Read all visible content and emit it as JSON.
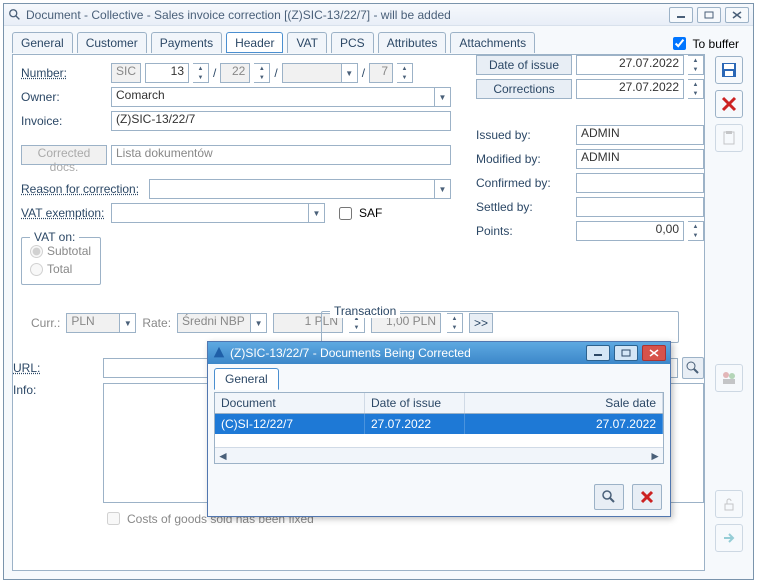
{
  "window": {
    "title": "Document - Collective - Sales invoice correction  [(Z)SIC-13/22/7]  - will be added"
  },
  "tabs": [
    "General",
    "Customer",
    "Payments",
    "Header",
    "VAT",
    "PCS",
    "Attributes",
    "Attachments"
  ],
  "active_tab": "Header",
  "to_buffer_label": "To buffer",
  "header": {
    "number_label": "Number:",
    "number_prefix": "SIC",
    "number_main": "13",
    "number_seg2": "22",
    "number_seg3": "",
    "number_seg4": "7",
    "owner_label": "Owner:",
    "owner_value": "Comarch",
    "invoice_label": "Invoice:",
    "invoice_value": "(Z)SIC-13/22/7",
    "corrected_docs_btn": "Corrected docs.",
    "corrected_docs_value": "Lista dokumentów",
    "reason_label": "Reason for correction:",
    "vat_exemption_label": "VAT exemption:",
    "saf_label": "SAF",
    "date_of_issue_btn": "Date of issue",
    "date_of_issue_value": "27.07.2022",
    "corrections_btn": "Corrections",
    "corrections_value": "27.07.2022",
    "issued_by_label": "Issued by:",
    "issued_by_value": "ADMIN",
    "modified_by_label": "Modified by:",
    "modified_by_value": "ADMIN",
    "confirmed_by_label": "Confirmed by:",
    "confirmed_by_value": "",
    "settled_by_label": "Settled by:",
    "settled_by_value": "",
    "points_label": "Points:",
    "points_value": "0,00"
  },
  "vat_on": {
    "legend": "VAT on:",
    "subtotal": "Subtotal",
    "total": "Total",
    "curr_label": "Curr.:",
    "curr_value": "PLN",
    "rate_label": "Rate:",
    "rate_type": "Średni NBP",
    "rate_left": "1 PLN",
    "rate_right": "1,00 PLN",
    "go_btn": ">>"
  },
  "transaction_legend": "Transaction",
  "url_label": "URL:",
  "info_label": "Info:",
  "costs_checkbox": "Costs of goods sold has been fixed",
  "sub": {
    "title": "(Z)SIC-13/22/7 - Documents Being Corrected",
    "tab": "General",
    "columns": {
      "doc": "Document",
      "date": "Date of issue",
      "sale": "Sale date"
    },
    "row": {
      "doc": "(C)SI-12/22/7",
      "date": "27.07.2022",
      "sale": "27.07.2022"
    }
  }
}
